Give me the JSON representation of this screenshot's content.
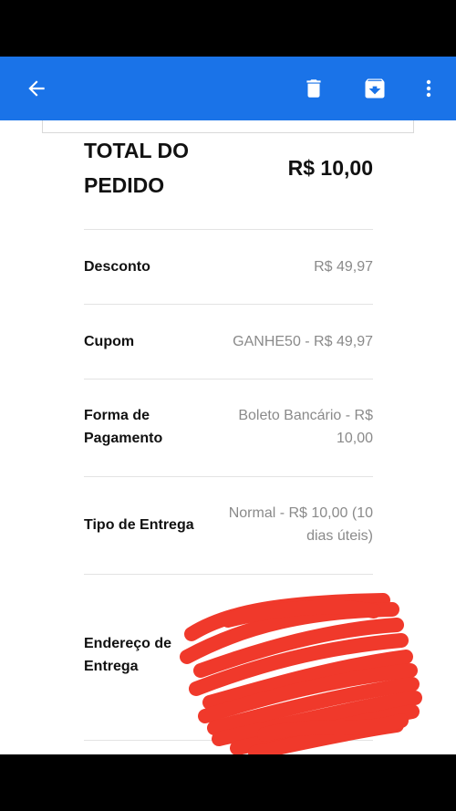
{
  "toolbar": {
    "back_icon": "arrow-left-icon",
    "delete_icon": "trash-icon",
    "archive_icon": "archive-icon",
    "more_icon": "more-vert-icon",
    "color": "#1a73e8"
  },
  "order": {
    "total_label_line1": "TOTAL DO",
    "total_label_line2": "PEDIDO",
    "total_value": "R$ 10,00",
    "rows": [
      {
        "label": "Desconto",
        "value": "R$ 49,97"
      },
      {
        "label": "Cupom",
        "value": "GANHE50 - R$ 49,97"
      },
      {
        "label_line1": "Forma de",
        "label_line2": "Pagamento",
        "value_line1": "Boleto Bancário - R$",
        "value_line2": "10,00"
      },
      {
        "label": "Tipo de Entrega",
        "value_line1": "Normal - R$ 10,00 (10",
        "value_line2": "dias úteis)"
      },
      {
        "label_line1": "Endereço de",
        "label_line2": "Entrega"
      }
    ]
  },
  "redaction_color": "#f0392b"
}
